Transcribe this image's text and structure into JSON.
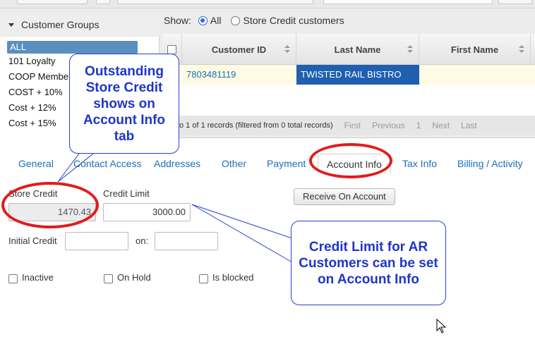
{
  "groups": {
    "title": "Customer Groups",
    "items": [
      "ALL",
      "101 Loyalty",
      "COOP Member",
      "COST + 10%",
      "Cost + 12%",
      "Cost + 15%"
    ]
  },
  "show_filter": {
    "label": "Show:",
    "options": [
      "All",
      "Store Credit customers"
    ],
    "selected": "All"
  },
  "grid": {
    "columns": [
      "Customer ID",
      "Last Name",
      "First Name"
    ],
    "rows": [
      {
        "customer_id": "7803481119",
        "last_name": "TWISTED RAIL BISTRO",
        "first_name": ""
      }
    ]
  },
  "pager": {
    "info": "o 1 of 1 records (filtered from 0 total records)",
    "buttons": [
      "First",
      "Previous",
      "1",
      "Next",
      "Last"
    ]
  },
  "tabs": [
    "General",
    "Contact Access",
    "Addresses",
    "Other",
    "Payment",
    "Account Info",
    "Tax Info",
    "Billing / Activity"
  ],
  "active_tab": "Account Info",
  "account_info": {
    "store_credit_label": "Store Credit",
    "store_credit_value": "1470.43",
    "credit_limit_label": "Credit Limit",
    "credit_limit_value": "3000.00",
    "receive_button": "Receive On Account",
    "initial_credit_label": "Initial Credit",
    "on_label": "on:",
    "checkboxes": [
      "Inactive",
      "On Hold",
      "Is blocked"
    ]
  },
  "callouts": {
    "left": "Outstanding Store Credit shows on Account Info tab",
    "right": "Credit Limit for AR Customers can be set on Account Info"
  },
  "colors": {
    "link": "#1a6fb8",
    "selection": "#1f5fb0",
    "highlight_ring": "#e21b1b",
    "callout_text": "#1f35c9"
  }
}
